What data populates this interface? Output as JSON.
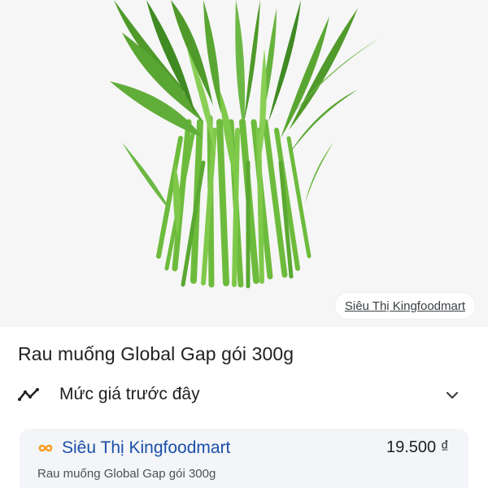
{
  "image": {
    "source_label": "Siêu Thị Kingfoodmart"
  },
  "product": {
    "title": "Rau muống Global Gap gói 300g"
  },
  "price_history": {
    "label": "Mức giá trước đây"
  },
  "offer": {
    "store_name": "Siêu Thị Kingfoodmart",
    "price": "19.500 ₫",
    "product_name": "Rau muống Global Gap gói 300g"
  },
  "colors": {
    "link_blue": "#1a4fa8",
    "card_background": "#f3f5f8",
    "logo_orange": "#f29b1d"
  },
  "icons": {
    "trend": "trending-icon",
    "expand": "chevron-down-icon",
    "store": "store-logo-icon"
  }
}
